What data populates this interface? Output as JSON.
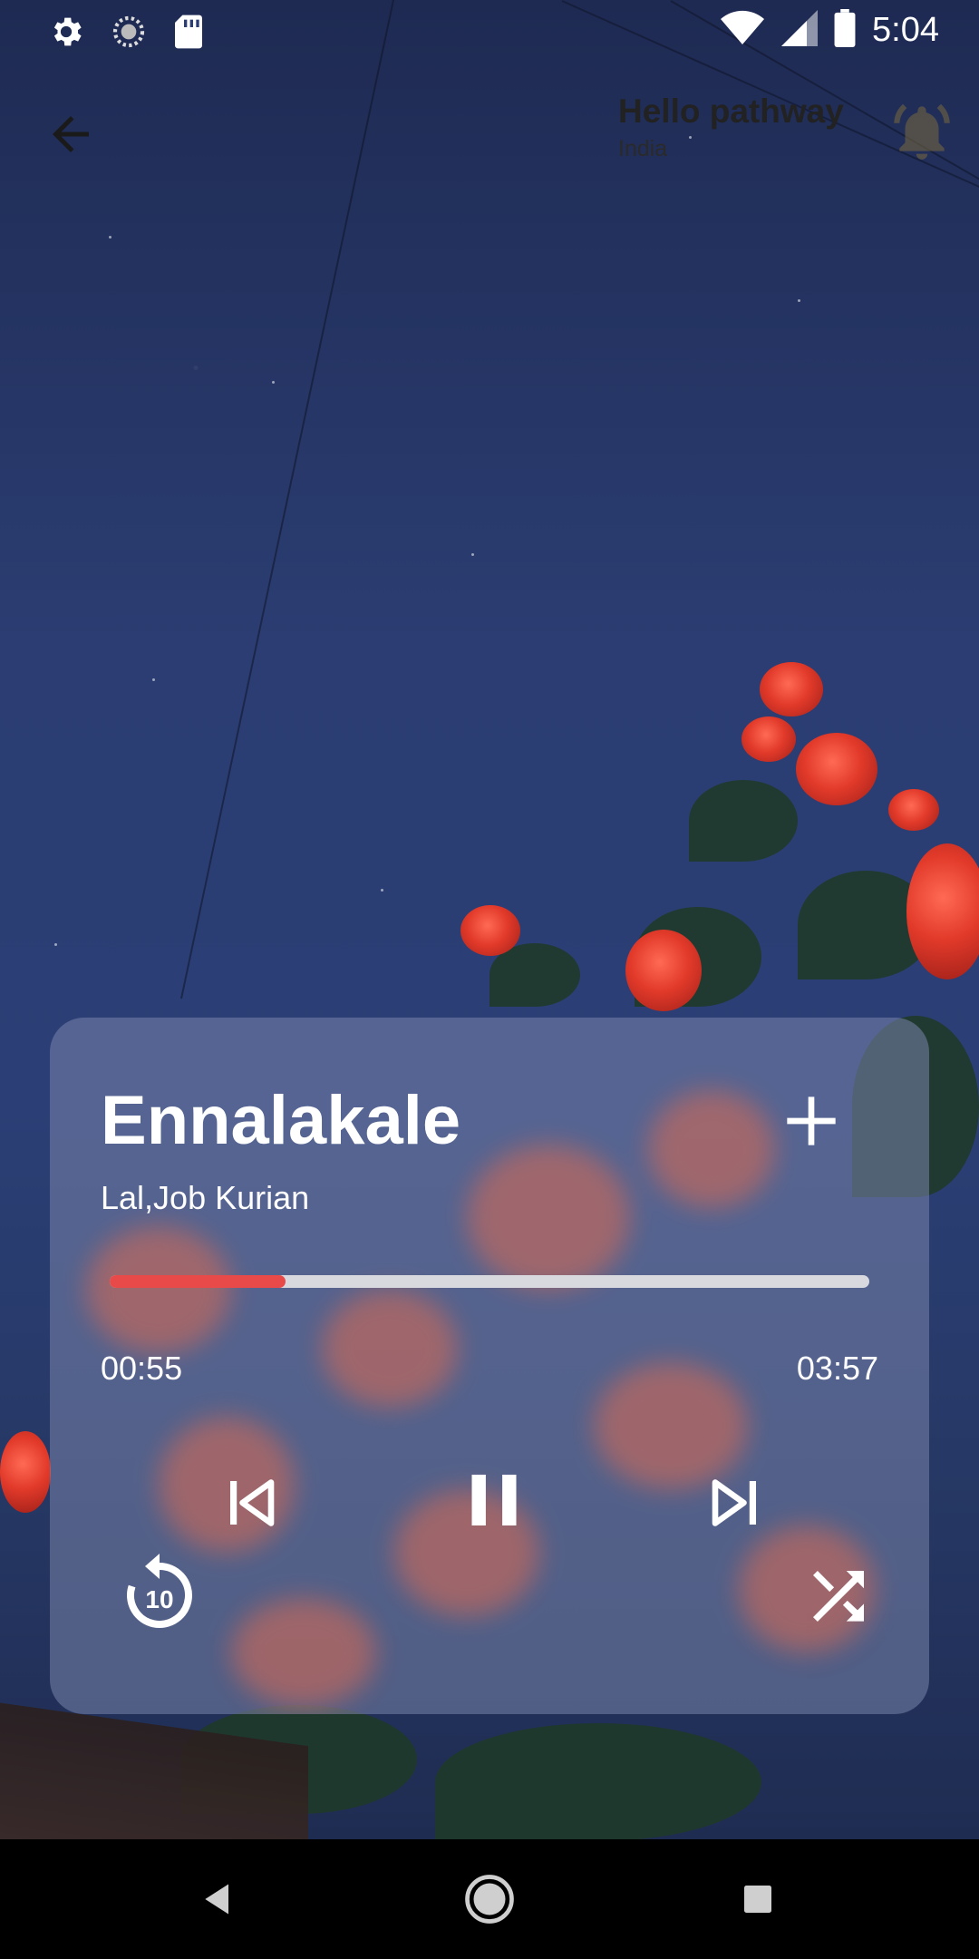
{
  "status_bar": {
    "time": "5:04",
    "left_icons": [
      "gear-icon",
      "sync-icon",
      "sd-card-icon"
    ],
    "right_icons": [
      "wifi-icon",
      "signal-icon",
      "battery-icon"
    ]
  },
  "header": {
    "back_icon": "arrow-left-icon",
    "greeting": "Hello pathway",
    "location": "India",
    "notification_icon": "bell-icon"
  },
  "player": {
    "title": "Ennalakale",
    "artist": "Lal,Job Kurian",
    "current_time": "00:55",
    "total_time": "03:57",
    "progress_fraction": 0.232,
    "colors": {
      "progress_fill": "#e84a4a",
      "progress_track": "#d8d8df"
    },
    "controls": {
      "add": "plus-icon",
      "previous": "skip-previous-icon",
      "pause": "pause-icon",
      "next": "skip-next-icon",
      "replay": "replay-10-icon",
      "replay_label": "10",
      "shuffle": "shuffle-icon"
    }
  },
  "nav_bar": {
    "items": [
      "nav-back-icon",
      "nav-home-icon",
      "nav-recents-icon"
    ]
  }
}
